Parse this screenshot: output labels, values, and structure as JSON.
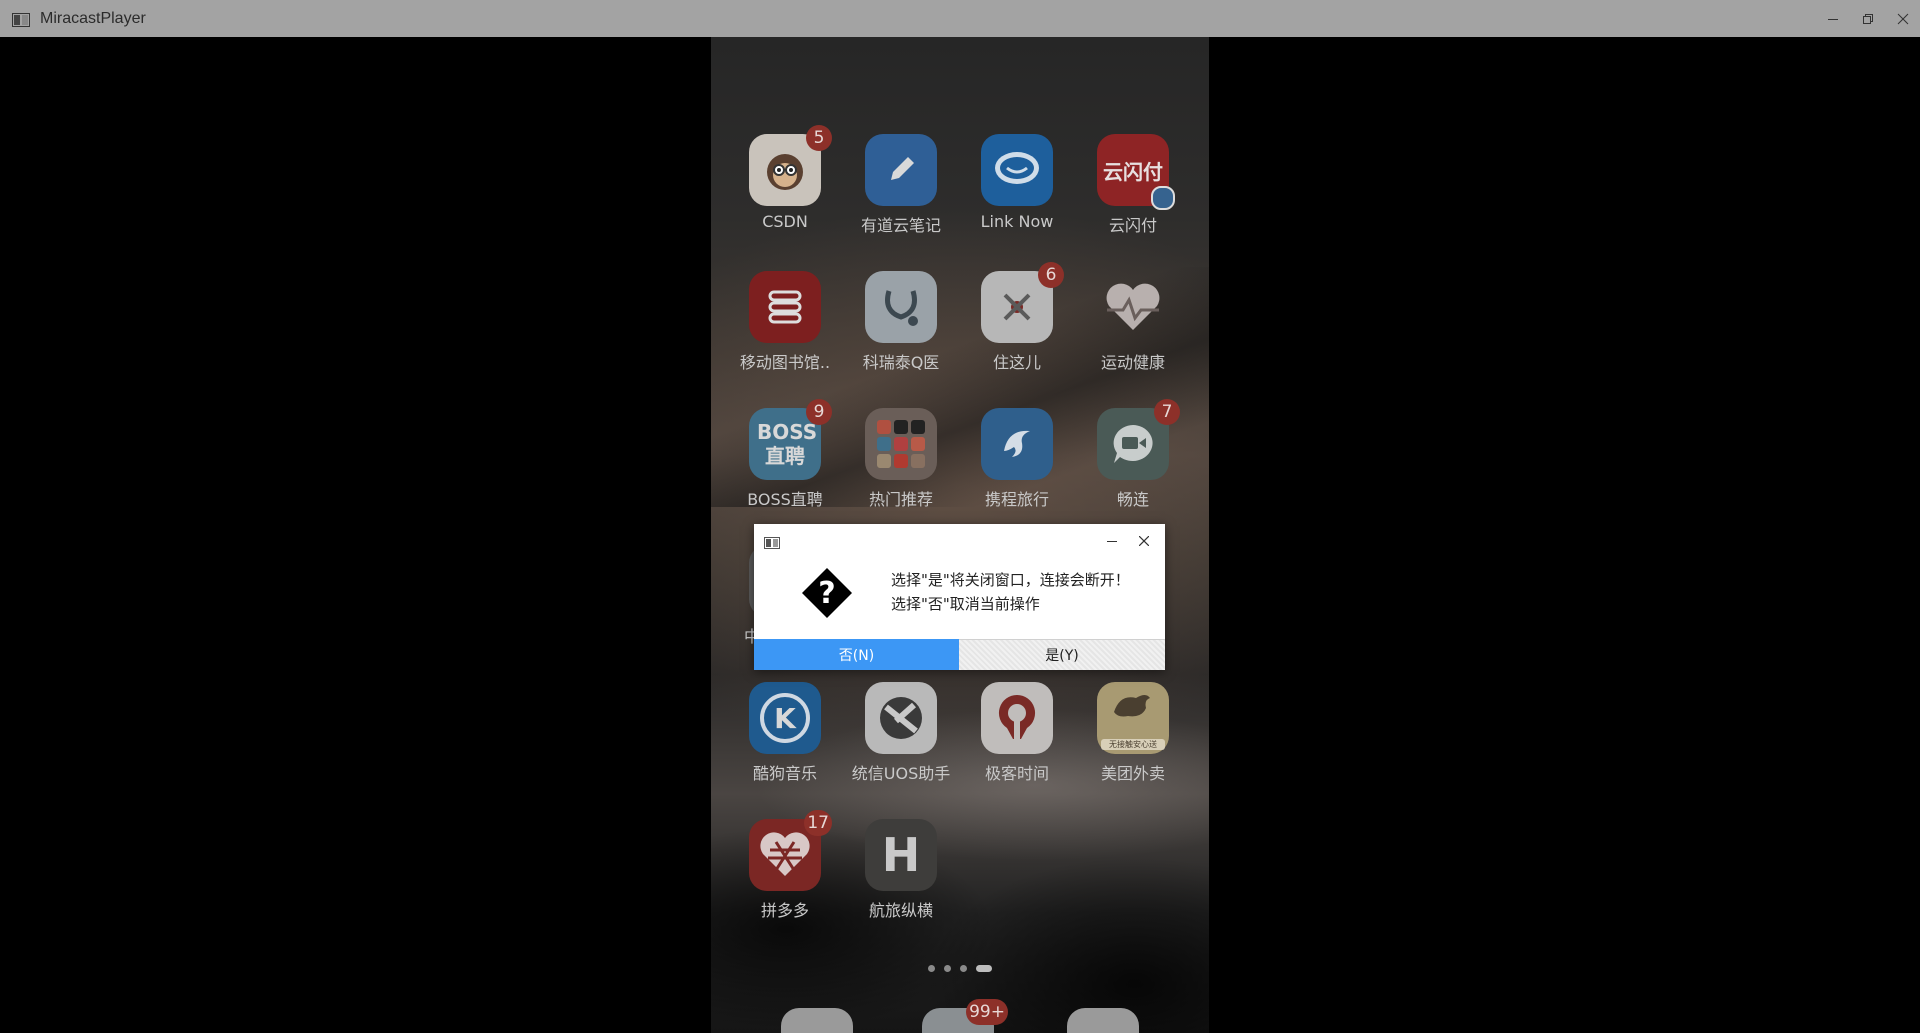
{
  "window": {
    "title": "MiracastPlayer",
    "icons": [
      "app-icon",
      "minimize-icon",
      "restore-icon",
      "close-icon"
    ]
  },
  "phone": {
    "apps": [
      {
        "label": "CSDN",
        "badge": "5",
        "icon": "csdn-monkey-icon",
        "color": "#c9c3bb"
      },
      {
        "label": "有道云笔记",
        "badge": "",
        "icon": "youdao-pen-icon",
        "color": "#2f5f96"
      },
      {
        "label": "Link Now",
        "badge": "",
        "icon": "link-now-chat-icon",
        "color": "#1e5f9c"
      },
      {
        "label": "云闪付",
        "badge": "",
        "icon": "unionpay-icon",
        "color": "#8e2425",
        "icon_text": "云闪付"
      },
      {
        "label": "移动图书馆..",
        "badge": "",
        "icon": "library-books-icon",
        "color": "#7d1f1f"
      },
      {
        "label": "科瑞泰Q医",
        "badge": "",
        "icon": "stethoscope-icon",
        "color": "#9aa2a8"
      },
      {
        "label": "住这儿",
        "badge": "6",
        "icon": "zhuzheer-icon",
        "color": "#b7b7b7"
      },
      {
        "label": "运动健康",
        "badge": "",
        "icon": "heart-icon",
        "color": "#5a5250"
      },
      {
        "label": "BOSS直聘",
        "badge": "9",
        "icon": "boss-zhipin-icon",
        "color": "#3f6f8a",
        "icon_text": "BOSS 直聘"
      },
      {
        "label": "热门推荐",
        "badge": "",
        "icon": "folder-grid-icon",
        "color": "#6a5e58"
      },
      {
        "label": "携程旅行",
        "badge": "",
        "icon": "dolphin-icon",
        "color": "#2f5f8c"
      },
      {
        "label": "畅连",
        "badge": "7",
        "icon": "video-chat-icon",
        "color": "#4a5a56"
      },
      {
        "label": "中",
        "badge": "",
        "icon": "hidden-app-icon",
        "color": "#5a5a5a"
      },
      {
        "label": "酷狗音乐",
        "badge": "",
        "icon": "kugou-k-icon",
        "color": "#1f5a8e",
        "icon_text": "K"
      },
      {
        "label": "统信UOS助手",
        "badge": "",
        "icon": "uos-assistant-icon",
        "color": "#b9b9b9"
      },
      {
        "label": "极客时间",
        "badge": "",
        "icon": "geek-time-icon",
        "color": "#c0bdbb"
      },
      {
        "label": "美团外卖",
        "badge": "",
        "icon": "kangaroo-icon",
        "color": "#a89a72",
        "icon_text": "无接触安心送"
      },
      {
        "label": "拼多多",
        "badge": "17",
        "icon": "pinduoduo-heart-icon",
        "color": "#7b2724"
      },
      {
        "label": "航旅纵横",
        "badge": "",
        "icon": "hanglv-icon",
        "color": "#3e3d3b",
        "icon_text": "H"
      }
    ],
    "dock": [
      {
        "icon": "phone-icon",
        "badge": ""
      },
      {
        "icon": "messages-icon",
        "badge": "99+"
      },
      {
        "icon": "camera-icon",
        "badge": ""
      }
    ],
    "page_indicator": {
      "total": 4,
      "active": 4
    }
  },
  "dialog": {
    "message_line1": "选择\"是\"将关闭窗口，连接会断开！",
    "message_line2": "选择\"否\"取消当前操作",
    "no_label": "否(N)",
    "yes_label": "是(Y)",
    "icons": [
      "question-icon",
      "minimize-icon",
      "close-icon"
    ],
    "accent": "#3c97f5"
  }
}
